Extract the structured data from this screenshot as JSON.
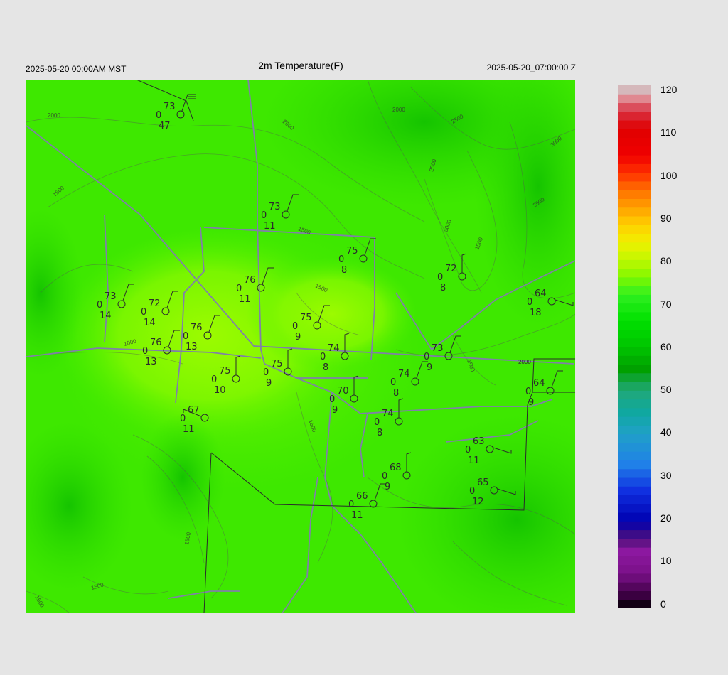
{
  "header": {
    "title": "2m Temperature(F)",
    "local_time": "2025-05-20 00:00AM MST",
    "utc_time": "2025-05-20_07:00:00 Z"
  },
  "colorbar": {
    "labels": [
      "120",
      "110",
      "100",
      "90",
      "80",
      "70",
      "60",
      "50",
      "40",
      "30",
      "20",
      "10",
      "0"
    ]
  },
  "contour_labels": [
    "2000",
    "2000",
    "2000",
    "2500",
    "3000",
    "2500",
    "2500",
    "3000",
    "2000",
    "1500",
    "1500",
    "1500",
    "1500",
    "1000",
    "1500",
    "2000",
    "1500",
    "1500",
    "1500",
    "1500"
  ],
  "stations": [
    {
      "temp": "73",
      "dew": "0",
      "vis": "47"
    },
    {
      "temp": "73",
      "dew": "0",
      "vis": "11"
    },
    {
      "temp": "75",
      "dew": "0",
      "vis": "8"
    },
    {
      "temp": "72",
      "dew": "0",
      "vis": "8"
    },
    {
      "temp": "76",
      "dew": "0",
      "vis": "11"
    },
    {
      "temp": "73",
      "dew": "0",
      "vis": "14"
    },
    {
      "temp": "72",
      "dew": "0",
      "vis": "14"
    },
    {
      "temp": "64",
      "dew": "0",
      "vis": "18"
    },
    {
      "temp": "75",
      "dew": "0",
      "vis": "9"
    },
    {
      "temp": "76",
      "dew": "0",
      "vis": "13"
    },
    {
      "temp": "76",
      "dew": "0",
      "vis": "13"
    },
    {
      "temp": "74",
      "dew": "0",
      "vis": "8"
    },
    {
      "temp": "73",
      "dew": "0",
      "vis": "9"
    },
    {
      "temp": "75",
      "dew": "0",
      "vis": "9"
    },
    {
      "temp": "75",
      "dew": "0",
      "vis": "10"
    },
    {
      "temp": "74",
      "dew": "0",
      "vis": "8"
    },
    {
      "temp": "64",
      "dew": "0",
      "vis": "9"
    },
    {
      "temp": "70",
      "dew": "0",
      "vis": "9"
    },
    {
      "temp": "67",
      "dew": "0",
      "vis": "11"
    },
    {
      "temp": "74",
      "dew": "0",
      "vis": "8"
    },
    {
      "temp": "63",
      "dew": "0",
      "vis": "11"
    },
    {
      "temp": "68",
      "dew": "0",
      "vis": "9"
    },
    {
      "temp": "65",
      "dew": "0",
      "vis": "12"
    },
    {
      "temp": "66",
      "dew": "0",
      "vis": "11"
    }
  ]
}
